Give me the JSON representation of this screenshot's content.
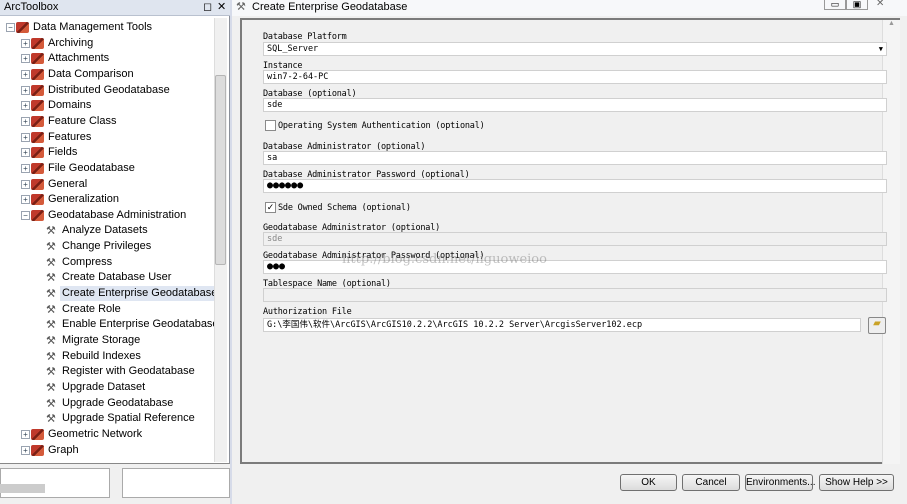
{
  "toolbox": {
    "title": "ArcToolbox",
    "root": "Data Management Tools",
    "toolsets": [
      "Archiving",
      "Attachments",
      "Data Comparison",
      "Distributed Geodatabase",
      "Domains",
      "Feature Class",
      "Features",
      "Fields",
      "File Geodatabase",
      "General",
      "Generalization",
      "Geodatabase Administration"
    ],
    "tools": [
      "Analyze Datasets",
      "Change Privileges",
      "Compress",
      "Create Database User",
      "Create Enterprise Geodatabase",
      "Create Role",
      "Enable Enterprise Geodatabase",
      "Migrate Storage",
      "Rebuild Indexes",
      "Register with Geodatabase",
      "Upgrade Dataset",
      "Upgrade Geodatabase",
      "Upgrade Spatial Reference"
    ],
    "after": [
      "Geometric Network",
      "Graph"
    ],
    "selected_tool": "Create Enterprise Geodatabase"
  },
  "dialog": {
    "title": "Create Enterprise Geodatabase",
    "fields": {
      "platform_label": "Database Platform",
      "platform_value": "SQL_Server",
      "instance_label": "Instance",
      "instance_value": "win7-2-64-PC",
      "database_label": "Database (optional)",
      "database_value": "sde",
      "os_auth_label": "Operating System Authentication (optional)",
      "os_auth_checked": false,
      "dba_label": "Database Administrator (optional)",
      "dba_value": "sa",
      "dba_pw_label": "Database Administrator Password (optional)",
      "dba_pw_value": "●●●●●●",
      "sde_schema_label": "Sde Owned Schema (optional)",
      "sde_schema_checked": true,
      "gdb_admin_label": "Geodatabase Administrator (optional)",
      "gdb_admin_value": "sde",
      "gdb_pw_label": "Geodatabase Administrator Password (optional)",
      "gdb_pw_value": "●●●",
      "tablespace_label": "Tablespace Name (optional)",
      "tablespace_value": "",
      "auth_label": "Authorization File",
      "auth_value": "G:\\李国伟\\软件\\ArcGIS\\ArcGIS10.2.2\\ArcGIS 10.2.2 Server\\ArcgisServer102.ecp"
    },
    "watermark": "http://blog.csdn.net/liguoweioo",
    "buttons": {
      "ok": "OK",
      "cancel": "Cancel",
      "env": "Environments...",
      "help": "Show Help >>"
    }
  }
}
